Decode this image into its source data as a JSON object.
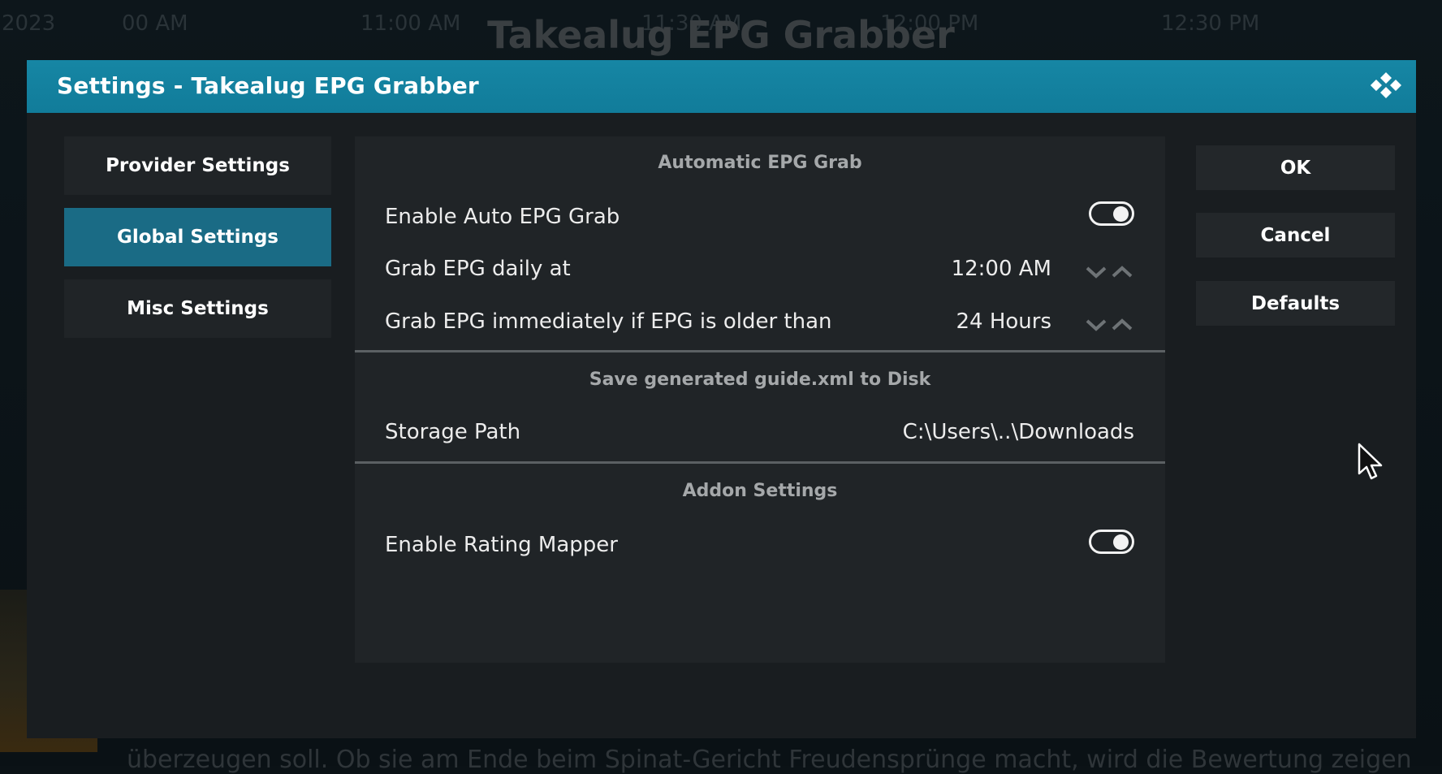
{
  "background": {
    "title": "Takealug EPG Grabber",
    "times": [
      "2023",
      "00 AM",
      "11:00 AM",
      "11:30 AM",
      "12:00 PM",
      "12:30 PM"
    ],
    "bottom_text": "überzeugen soll. Ob sie am Ende beim Spinat-Gericht Freudensprünge macht, wird die Bewertung zeigen"
  },
  "dialog": {
    "title": "Settings - Takealug EPG Grabber",
    "logo_icon": "kodi-logo-icon"
  },
  "categories": [
    {
      "label": "Provider Settings",
      "active": false
    },
    {
      "label": "Global Settings",
      "active": true
    },
    {
      "label": "Misc Settings",
      "active": false
    }
  ],
  "groups": {
    "auto": {
      "header": "Automatic EPG Grab",
      "enable_auto": {
        "label": "Enable Auto EPG Grab",
        "enabled": true
      },
      "daily_at": {
        "label": "Grab EPG daily at",
        "value": "12:00 AM"
      },
      "older_than": {
        "label": "Grab EPG immediately if EPG is older than",
        "value": "24 Hours"
      }
    },
    "save": {
      "header": "Save generated guide.xml to Disk",
      "storage_path": {
        "label": "Storage Path",
        "value": "C:\\Users\\..\\Downloads"
      }
    },
    "addon": {
      "header": "Addon Settings",
      "rating_mapper": {
        "label": "Enable Rating Mapper",
        "enabled": true
      }
    }
  },
  "buttons": {
    "ok": "OK",
    "cancel": "Cancel",
    "defaults": "Defaults"
  },
  "colors": {
    "titlebar": "#117c9a",
    "active_category": "#1a6b85",
    "panel": "#202427",
    "dialog": "#191d20"
  }
}
